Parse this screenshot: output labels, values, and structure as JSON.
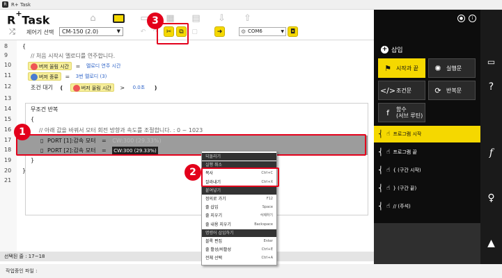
{
  "app": {
    "title": "R+ Task",
    "logo": "R+Task"
  },
  "toolbar": {
    "controller_label": "제어기 선택",
    "controller_value": "CM-150 (2.0)",
    "port_value": "COM6"
  },
  "editor": {
    "lines": [
      {
        "n": "8",
        "text": "{"
      },
      {
        "n": "9",
        "text": "//   처음 시작시 멜로디를 연주합니다."
      },
      {
        "n": "10",
        "block": "버저 울림 시간",
        "op": "=",
        "value": "멜로디 연주 시간"
      },
      {
        "n": "11",
        "block": "버저 종류",
        "op": "=",
        "value": "3번 멜로디 (3)"
      },
      {
        "n": "12",
        "pre": "조건 대기",
        "paren_open": "(",
        "block": "버저 울림 시간",
        "op": ">",
        "value": "0.0초",
        "paren_close": ")"
      },
      {
        "n": "13",
        "text": ""
      },
      {
        "n": "14",
        "text": "무조건 반복"
      },
      {
        "n": "15",
        "text": "{"
      },
      {
        "n": "16",
        "text": "//   아래 값을 바꿔서 모터 회전 방향과 속도를 조절합니다. : 0 ~ 1023"
      },
      {
        "n": "17",
        "block": "PORT [1]:감속 모터",
        "op": "=",
        "value": "CW:300 (29.33%)"
      },
      {
        "n": "18",
        "block": "PORT [2]:감속 모터",
        "op": "=",
        "value": "CW:300 (29.33%)"
      },
      {
        "n": "19",
        "text": "}"
      },
      {
        "n": "20",
        "text": "}"
      },
      {
        "n": "21",
        "text": ""
      }
    ]
  },
  "status": {
    "selection": "선택된 줄 : 17~18",
    "working_file": "작업중인 파일 :"
  },
  "context_menu": {
    "items": [
      {
        "label": "되돌리기",
        "shortcut": "",
        "state": "sec"
      },
      {
        "label": "실행 취소",
        "shortcut": "",
        "state": "sec"
      },
      {
        "label": "복사",
        "shortcut": "Ctrl+C",
        "state": "normal"
      },
      {
        "label": "잘라내기",
        "shortcut": "Ctrl+X",
        "state": "normal"
      },
      {
        "label": "붙여넣기",
        "shortcut": "",
        "state": "sec"
      },
      {
        "label": "정의로 가기",
        "shortcut": "F12",
        "state": "normal"
      },
      {
        "label": "줄 삽입",
        "shortcut": "Space",
        "state": "normal"
      },
      {
        "label": "줄 지우기",
        "shortcut": "삭제하기",
        "state": "normal"
      },
      {
        "label": "줄 내용 지우기",
        "shortcut": "Backspace",
        "state": "normal"
      },
      {
        "label": "명령어 삽입하기",
        "shortcut": "",
        "state": "sec"
      },
      {
        "label": "블록 편집",
        "shortcut": "Enter",
        "state": "normal"
      },
      {
        "label": "줄 활성/비활성",
        "shortcut": "Ctrl+E",
        "state": "normal"
      },
      {
        "label": "전체 선택",
        "shortcut": "Ctrl+A",
        "state": "normal"
      }
    ]
  },
  "callouts": {
    "one": "1",
    "two": "2",
    "three": "3"
  },
  "right_panel": {
    "insert_label": "삽입",
    "categories": [
      {
        "label": "시작과 끝",
        "icon": "flag-icon"
      },
      {
        "label": "실행문",
        "icon": "spinner-icon"
      },
      {
        "label": "조건문",
        "icon": "code-icon"
      },
      {
        "label": "반복문",
        "icon": "loop-icon"
      },
      {
        "label": "함수\n(서브 루틴)",
        "icon": "function-icon"
      }
    ],
    "commands": [
      {
        "label": "프로그램 시작",
        "active": true
      },
      {
        "label": "프로그램 끝",
        "active": false
      },
      {
        "label": "{ (구간 시작)",
        "active": false
      },
      {
        "label": "} (구간 끝)",
        "active": false
      },
      {
        "label": "// (주석)",
        "active": false
      }
    ]
  },
  "colors": {
    "accent": "#f5d800",
    "callout": "#e3001b",
    "panel": "#0d0d0d"
  }
}
